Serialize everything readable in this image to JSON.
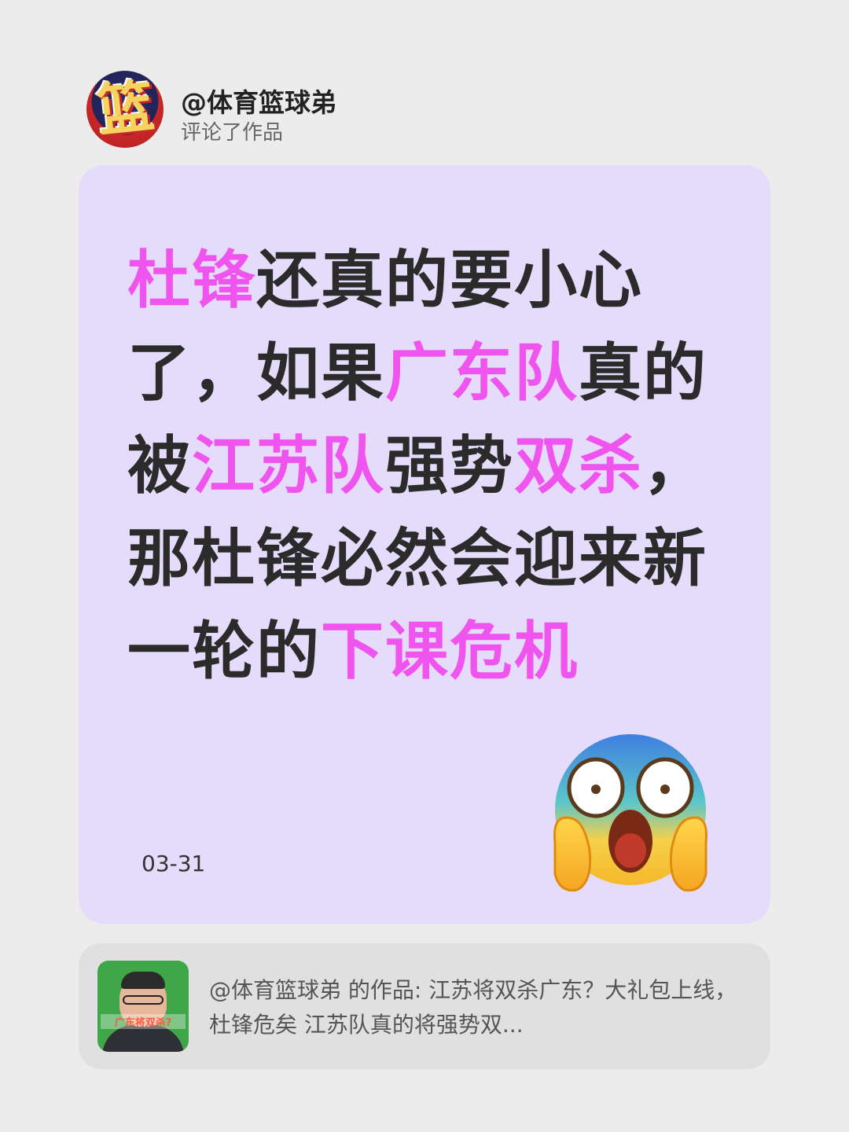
{
  "header": {
    "avatar_glyph": "篮",
    "username": "@体育篮球弟",
    "action": "评论了作品"
  },
  "card": {
    "comment_segments": [
      {
        "text": "杜锋",
        "highlight": true
      },
      {
        "text": "还真的要小心了，如果",
        "highlight": false
      },
      {
        "text": "广东队",
        "highlight": true
      },
      {
        "text": "真的被",
        "highlight": false
      },
      {
        "text": "江苏队",
        "highlight": true
      },
      {
        "text": "强势",
        "highlight": false
      },
      {
        "text": "双杀",
        "highlight": true
      },
      {
        "text": "，那杜锋必然会迎来新一轮的",
        "highlight": false
      },
      {
        "text": "下课危机",
        "highlight": true
      }
    ],
    "date": "03-31",
    "emoji": "face-screaming-in-fear-icon",
    "highlight_color": "#f054ee"
  },
  "reference": {
    "thumbnail_caption": "广东将双杀?",
    "text": "@体育篮球弟 的作品: 江苏将双杀广东？大礼包上线，杜锋危矣 江苏队真的将强势双..."
  }
}
